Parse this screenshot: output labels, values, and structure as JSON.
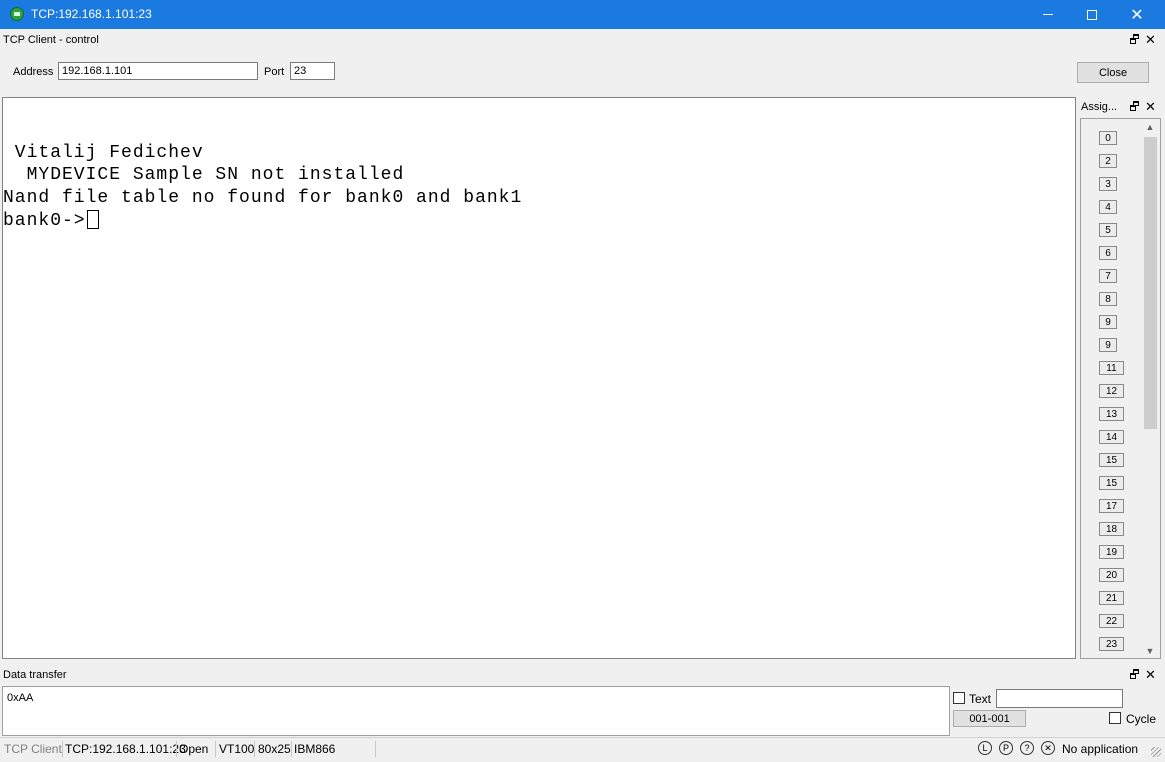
{
  "window": {
    "title": "TCP:192.168.1.101:23"
  },
  "control_panel": {
    "title": "TCP Client - control",
    "address_label": "Address",
    "address_value": "192.168.1.101",
    "port_label": "Port",
    "port_value": "23",
    "close_label": "Close"
  },
  "terminal": {
    "lines": [
      " Vitalij Fedichev",
      "  MYDEVICE Sample SN not installed",
      "Nand file table no found for bank0 and bank1",
      "bank0->"
    ]
  },
  "assign_panel": {
    "title": "Assig...",
    "keys": [
      "0",
      "2",
      "3",
      "4",
      "5",
      "6",
      "7",
      "8",
      "9",
      "9",
      "11",
      "12",
      "13",
      "14",
      "15",
      "15",
      "17",
      "18",
      "19",
      "20",
      "21",
      "22",
      "23"
    ]
  },
  "data_transfer": {
    "title": "Data transfer",
    "value": "0xAA",
    "text_label": "Text",
    "text_value": "",
    "counter_label": "001-001",
    "cycle_label": "Cycle"
  },
  "status_bar": {
    "mode": "TCP Client",
    "connection": "TCP:192.168.1.101:23",
    "state": "Open",
    "emulation": "VT100",
    "size": "80x25",
    "charset": "IBM866",
    "icons": [
      {
        "name": "l-circle-icon",
        "glyph": "L"
      },
      {
        "name": "p-circle-icon",
        "glyph": "P"
      },
      {
        "name": "help-circle-icon",
        "glyph": "?"
      },
      {
        "name": "x-circle-icon",
        "glyph": "✕"
      }
    ],
    "application": "No application"
  },
  "colors": {
    "titlebar": "#1a7ae0",
    "panel": "#f0f0f0",
    "terminal_bg": "#ffffff"
  }
}
